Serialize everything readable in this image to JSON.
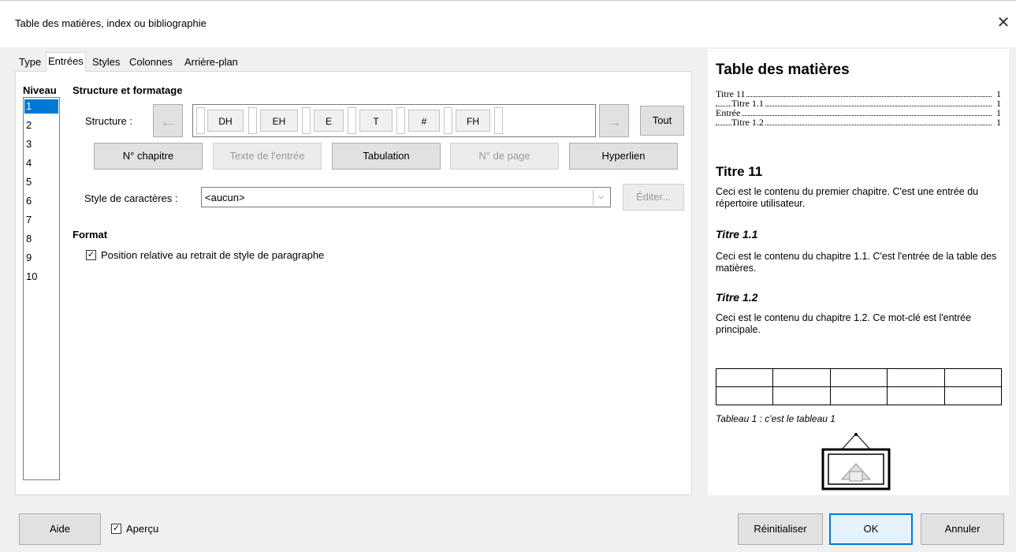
{
  "window": {
    "title": "Table des matières, index ou bibliographie",
    "close": "✕"
  },
  "tabs": [
    "Type",
    "Entrées",
    "Styles",
    "Colonnes",
    "Arrière-plan"
  ],
  "levels": {
    "header": "Niveau",
    "items": [
      "1",
      "2",
      "3",
      "4",
      "5",
      "6",
      "7",
      "8",
      "9",
      "10"
    ],
    "selected": "1"
  },
  "structure": {
    "section_title": "Structure et formatage",
    "label": "Structure :",
    "tokens": [
      "DH",
      "EH",
      "E",
      "T",
      "#",
      "FH"
    ],
    "all_button": "Tout"
  },
  "insert_buttons": {
    "chapter_no": "N° chapitre",
    "entry_text": "Texte de l'entrée",
    "tabulation": "Tabulation",
    "page_no": "N° de page",
    "hyperlink": "Hyperlien"
  },
  "char_style": {
    "label": "Style de caractères :",
    "value": "<aucun>",
    "edit": "Éditer..."
  },
  "format": {
    "title": "Format",
    "relative_label": "Position relative au retrait de style de paragraphe",
    "relative_checked": true
  },
  "preview": {
    "toc_title": "Table des matières",
    "toc_entries": [
      {
        "text": "Titre 11",
        "page": "1",
        "indent": false
      },
      {
        "text": "Titre 1.1",
        "page": "1",
        "indent": true
      },
      {
        "text": "Entrée",
        "page": "1",
        "indent": false
      },
      {
        "text": "Titre 1.2",
        "page": "1",
        "indent": true
      }
    ],
    "heading1": "Titre 11",
    "para1": "Ceci est le contenu du premier chapitre. C'est une entrée du répertoire utilisateur.",
    "heading2": "Titre 1.1",
    "para2": "Ceci est le contenu du chapitre 1.1. C'est l'entrée de la table des matières.",
    "heading3": "Titre 1.2",
    "para3": "Ceci est le contenu du chapitre 1.2. Ce mot-clé est l'entrée principale.",
    "table_caption": "Tableau 1 : c'est le tableau 1"
  },
  "footer": {
    "help": "Aide",
    "preview_label": "Aperçu",
    "preview_checked": true,
    "reset": "Réinitialiser",
    "ok": "OK",
    "cancel": "Annuler"
  },
  "colors": {
    "accent": "#0078d7"
  }
}
